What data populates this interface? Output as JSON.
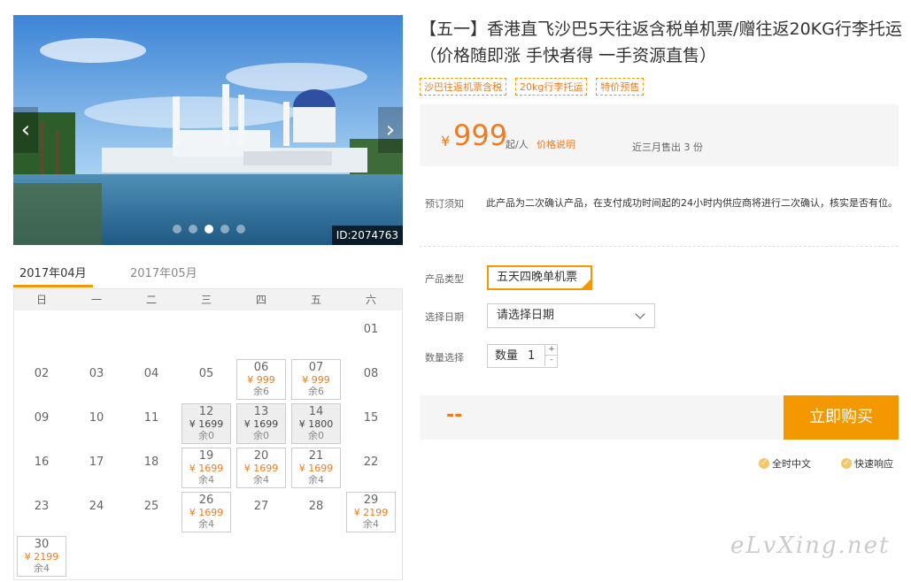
{
  "hero": {
    "image_id": "ID:2074763",
    "prev_arrow": "‹",
    "next_arrow": "›",
    "slides_count": 5,
    "active_slide": 3
  },
  "calendar": {
    "tabs": [
      "2017年04月",
      "2017年05月"
    ],
    "active_tab": 0,
    "weekdays": [
      "日",
      "一",
      "二",
      "三",
      "四",
      "五",
      "六"
    ],
    "weeks": [
      [
        null,
        null,
        null,
        null,
        null,
        null,
        {
          "day": "01"
        }
      ],
      [
        {
          "day": "02"
        },
        {
          "day": "03"
        },
        {
          "day": "04"
        },
        {
          "day": "05"
        },
        {
          "day": "06",
          "price": "¥ 999",
          "remain": "余6"
        },
        {
          "day": "07",
          "price": "¥ 999",
          "remain": "余6"
        },
        {
          "day": "08"
        }
      ],
      [
        {
          "day": "09"
        },
        {
          "day": "10"
        },
        {
          "day": "11"
        },
        {
          "day": "12",
          "price": "¥ 1699",
          "remain": "余0",
          "sold": true
        },
        {
          "day": "13",
          "price": "¥ 1699",
          "remain": "余0",
          "sold": true
        },
        {
          "day": "14",
          "price": "¥ 1800",
          "remain": "余0",
          "sold": true
        },
        {
          "day": "15"
        }
      ],
      [
        {
          "day": "16"
        },
        {
          "day": "17"
        },
        {
          "day": "18"
        },
        {
          "day": "19",
          "price": "¥ 1699",
          "remain": "余4"
        },
        {
          "day": "20",
          "price": "¥ 1699",
          "remain": "余4"
        },
        {
          "day": "21",
          "price": "¥ 1699",
          "remain": "余4"
        },
        {
          "day": "22"
        }
      ],
      [
        {
          "day": "23"
        },
        {
          "day": "24"
        },
        {
          "day": "25"
        },
        {
          "day": "26",
          "price": "¥ 1699",
          "remain": "余4"
        },
        {
          "day": "27"
        },
        {
          "day": "28"
        },
        {
          "day": "29",
          "price": "¥ 2199",
          "remain": "余4"
        }
      ],
      [
        {
          "day": "30",
          "price": "¥ 2199",
          "remain": "余4"
        },
        null,
        null,
        null,
        null,
        null,
        null
      ]
    ]
  },
  "product": {
    "title": "【五一】香港直飞沙巴5天往返含税单机票/赠往返20KG行李托运（价格随即涨 手快者得 一手资源直售）",
    "tags": [
      "沙巴往返机票含税",
      "20kg行李托运",
      "特价预售"
    ],
    "price_symbol": "¥",
    "price": "999",
    "price_unit": "起/人",
    "price_link": "价格说明",
    "sold_recent": "近三月售出 3 份",
    "notice_label": "预订须知",
    "notice_text": "此产品为二次确认产品，在支付成功时间起的24小时内供应商将进行二次确认，核实是否有位。",
    "type_label": "产品类型",
    "type_option": "五天四晚单机票",
    "date_label": "选择日期",
    "date_placeholder": "请选择日期",
    "qty_label": "数量选择",
    "qty_inner_label": "数量",
    "qty_value": "1",
    "qty_plus": "+",
    "qty_minus": "-",
    "total": "--",
    "buy_button": "立即购买",
    "assurances": [
      "全时中文",
      "快速响应"
    ]
  },
  "watermark": "eLvXing.net",
  "colors": {
    "accent": "#f39800",
    "price": "#f37b1d"
  }
}
